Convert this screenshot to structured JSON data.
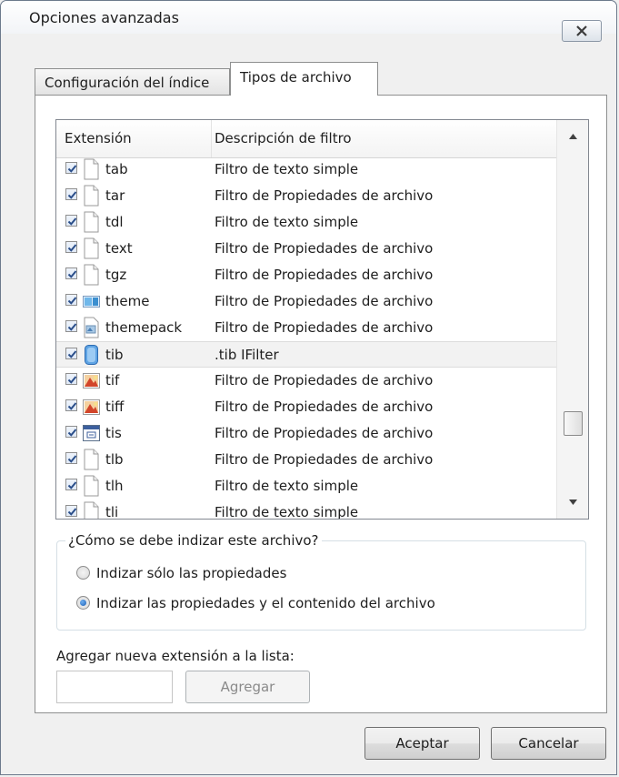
{
  "dialog": {
    "title": "Opciones avanzadas"
  },
  "tabs": [
    {
      "label": "Configuración del índice"
    },
    {
      "label": "Tipos de archivo"
    }
  ],
  "list": {
    "columns": {
      "ext": "Extensión",
      "desc": "Descripción de filtro"
    },
    "rows": [
      {
        "ext": "tab",
        "desc": "Filtro de texto simple",
        "icon": "document-icon"
      },
      {
        "ext": "tar",
        "desc": "Filtro de Propiedades de archivo",
        "icon": "document-icon"
      },
      {
        "ext": "tdl",
        "desc": "Filtro de texto simple",
        "icon": "document-icon"
      },
      {
        "ext": "text",
        "desc": "Filtro de Propiedades de archivo",
        "icon": "document-icon"
      },
      {
        "ext": "tgz",
        "desc": "Filtro de Propiedades de archivo",
        "icon": "document-icon"
      },
      {
        "ext": "theme",
        "desc": "Filtro de Propiedades de archivo",
        "icon": "theme-icon"
      },
      {
        "ext": "themepack",
        "desc": "Filtro de Propiedades de archivo",
        "icon": "themepack-icon"
      },
      {
        "ext": "tib",
        "desc": ".tib IFilter",
        "icon": "tib-icon"
      },
      {
        "ext": "tif",
        "desc": "Filtro de Propiedades de archivo",
        "icon": "image-icon"
      },
      {
        "ext": "tiff",
        "desc": "Filtro de Propiedades de archivo",
        "icon": "image-icon"
      },
      {
        "ext": "tis",
        "desc": "Filtro de Propiedades de archivo",
        "icon": "calendar-icon"
      },
      {
        "ext": "tlb",
        "desc": "Filtro de Propiedades de archivo",
        "icon": "document-icon"
      },
      {
        "ext": "tlh",
        "desc": "Filtro de texto simple",
        "icon": "document-icon"
      },
      {
        "ext": "tli",
        "desc": "Filtro de texto simple",
        "icon": "document-icon"
      }
    ]
  },
  "index_group": {
    "legend": "¿Cómo se debe indizar este archivo?",
    "options": [
      {
        "label": "Indizar sólo las propiedades",
        "selected": false
      },
      {
        "label": "Indizar las propiedades y el contenido del archivo",
        "selected": true
      }
    ]
  },
  "add_extension": {
    "label": "Agregar nueva extensión a la lista:",
    "value": "",
    "button": "Agregar"
  },
  "footer": {
    "ok": "Aceptar",
    "cancel": "Cancelar"
  }
}
